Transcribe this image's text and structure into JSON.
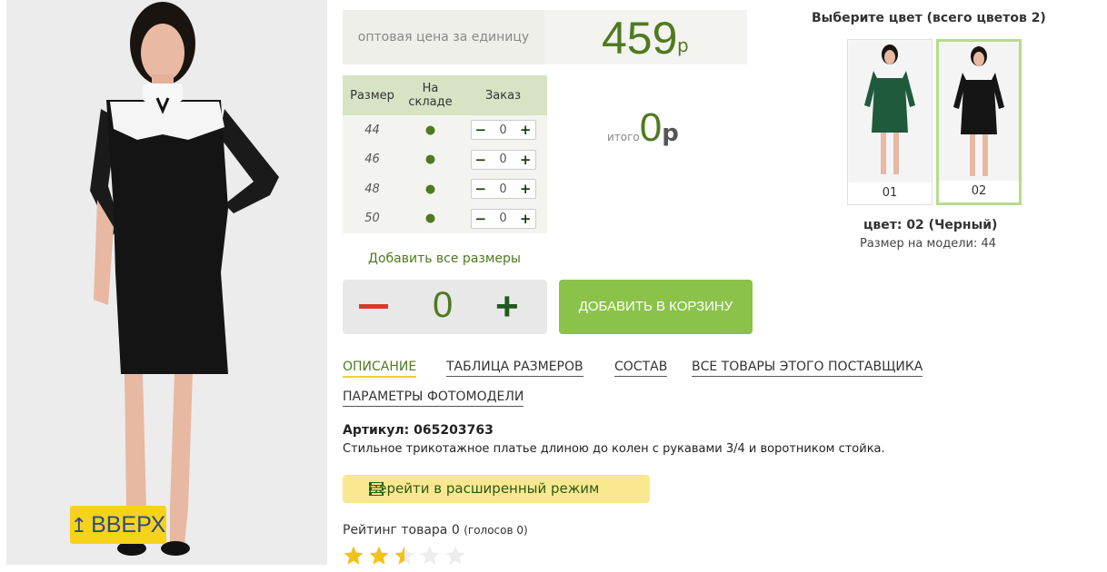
{
  "up_button": {
    "label": "ВВЕРХ"
  },
  "price": {
    "label": "оптовая цена за единицу",
    "value": "459",
    "currency": "р"
  },
  "size_table": {
    "headers": [
      "Размер",
      "На складе",
      "Заказ"
    ],
    "rows": [
      {
        "size": "44",
        "stock": "●",
        "qty": "0"
      },
      {
        "size": "46",
        "stock": "●",
        "qty": "0"
      },
      {
        "size": "48",
        "stock": "●",
        "qty": "0"
      },
      {
        "size": "50",
        "stock": "●",
        "qty": "0"
      }
    ],
    "minus": "−",
    "plus": "+"
  },
  "total": {
    "label": "итого",
    "value": "0",
    "currency": "р"
  },
  "add_all_sizes": "Добавить все размеры",
  "quantity": {
    "value": "0",
    "plus": "+"
  },
  "add_to_cart": "ДОБАВИТЬ В КОРЗИНУ",
  "tabs": [
    "ОПИСАНИЕ",
    "ТАБЛИЦА РАЗМЕРОВ",
    "СОСТАВ",
    "ВСЕ ТОВАРЫ ЭТОГО ПОСТАВЩИКА",
    "ПАРАМЕТРЫ ФОТОМОДЕЛИ"
  ],
  "article": "Артикул: 065203763",
  "description": "Стильное трикотажное платье длиною до колен с рукавами 3/4 и воротником стойка.",
  "expert_mode": "Перейти в расширенный режим",
  "rating": {
    "text": "Рейтинг товара 0",
    "votes": "(голосов 0)",
    "stars_filled": 2.5,
    "stars_total": 5
  },
  "colors": {
    "title": "Выберите цвет (всего цветов 2)",
    "options": [
      {
        "label": "01",
        "dress_color": "#1f5a3c"
      },
      {
        "label": "02",
        "dress_color": "#151515"
      }
    ],
    "selected": "цвет: 02 (Черный)",
    "model_size": "Размер на модели: 44"
  },
  "accent": {
    "green": "#4f7a20",
    "button_green": "#8bc34a",
    "yellow": "#f7d21c"
  }
}
